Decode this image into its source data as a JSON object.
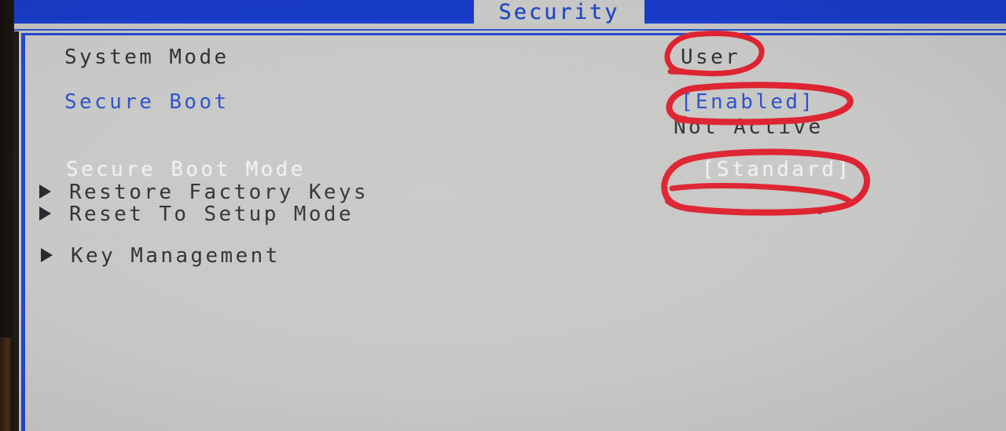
{
  "screen": {
    "type": "bios-setup-utility",
    "active_tab": "Security",
    "colors": {
      "menubar_blue": "#1438c8",
      "panel_gray": "#c9c9c7",
      "text_dark": "#2d2f33",
      "text_blue": "#2a51cb",
      "text_white_highlight": "#f2f2f0",
      "annotation_red": "#e0202e"
    }
  },
  "tabs": {
    "active_label": "Security"
  },
  "settings": [
    {
      "id": "system-mode",
      "label": "System Mode",
      "label_color": "dark",
      "value": "User",
      "value_color": "dark",
      "has_submenu": false,
      "annotated": true
    },
    {
      "id": "secure-boot",
      "label": "Secure Boot",
      "label_color": "blue",
      "value": "[Enabled]",
      "value_color": "blue",
      "has_submenu": false,
      "annotated": true
    },
    {
      "id": "secure-boot-status",
      "label": "",
      "label_color": "dark",
      "value": "Not Active",
      "value_color": "dark",
      "has_submenu": false,
      "annotated": false
    },
    {
      "id": "secure-boot-mode",
      "label": "Secure Boot Mode",
      "label_color": "white",
      "value": "[Standard]",
      "value_color": "white",
      "has_submenu": false,
      "annotated": true
    },
    {
      "id": "restore-factory-keys",
      "label": "Restore Factory Keys",
      "label_color": "dark",
      "value": "",
      "value_color": "dark",
      "has_submenu": true,
      "annotated": false
    },
    {
      "id": "reset-to-setup-mode",
      "label": "Reset To Setup Mode",
      "label_color": "dark",
      "value": "",
      "value_color": "dark",
      "has_submenu": true,
      "annotated": false
    },
    {
      "id": "key-management",
      "label": "Key Management",
      "label_color": "dark",
      "value": "",
      "value_color": "dark",
      "has_submenu": true,
      "annotated": false
    }
  ],
  "annotations": [
    {
      "id": "circle-user",
      "shape": "ellipse",
      "targets": "System Mode value"
    },
    {
      "id": "circle-enabled",
      "shape": "ellipse",
      "targets": "Secure Boot value"
    },
    {
      "id": "circle-standard",
      "shape": "ellipse",
      "targets": "Secure Boot Mode value"
    }
  ]
}
